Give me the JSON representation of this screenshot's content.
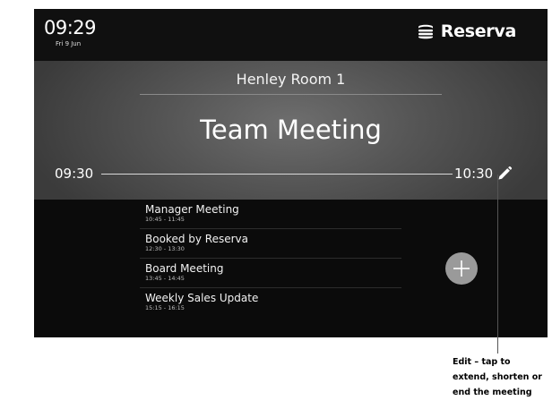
{
  "header": {
    "time": "09:29",
    "date": "Fri 9 Jun",
    "brand_name": "Reserva",
    "brand_icon": "stacked-layers-icon"
  },
  "current_meeting": {
    "room": "Henley Room 1",
    "title": "Team Meeting",
    "start": "09:30",
    "end": "10:30",
    "edit_icon": "pencil-icon"
  },
  "schedule": [
    {
      "title": "Manager Meeting",
      "time": "10:45 - 11:45"
    },
    {
      "title": "Booked by Reserva",
      "time": "12:30 - 13:30"
    },
    {
      "title": "Board Meeting",
      "time": "13:45 - 14:45"
    },
    {
      "title": "Weekly Sales Update",
      "time": "15:15 - 16:15"
    }
  ],
  "add_button": {
    "icon": "plus-icon"
  },
  "annotation": {
    "lines": [
      "Edit – tap to",
      "extend, shorten or",
      "end the meeting"
    ]
  },
  "colors": {
    "background": "#0b0b0b",
    "panel": "#5a5a5a",
    "add_button": "#9a9a9a"
  }
}
